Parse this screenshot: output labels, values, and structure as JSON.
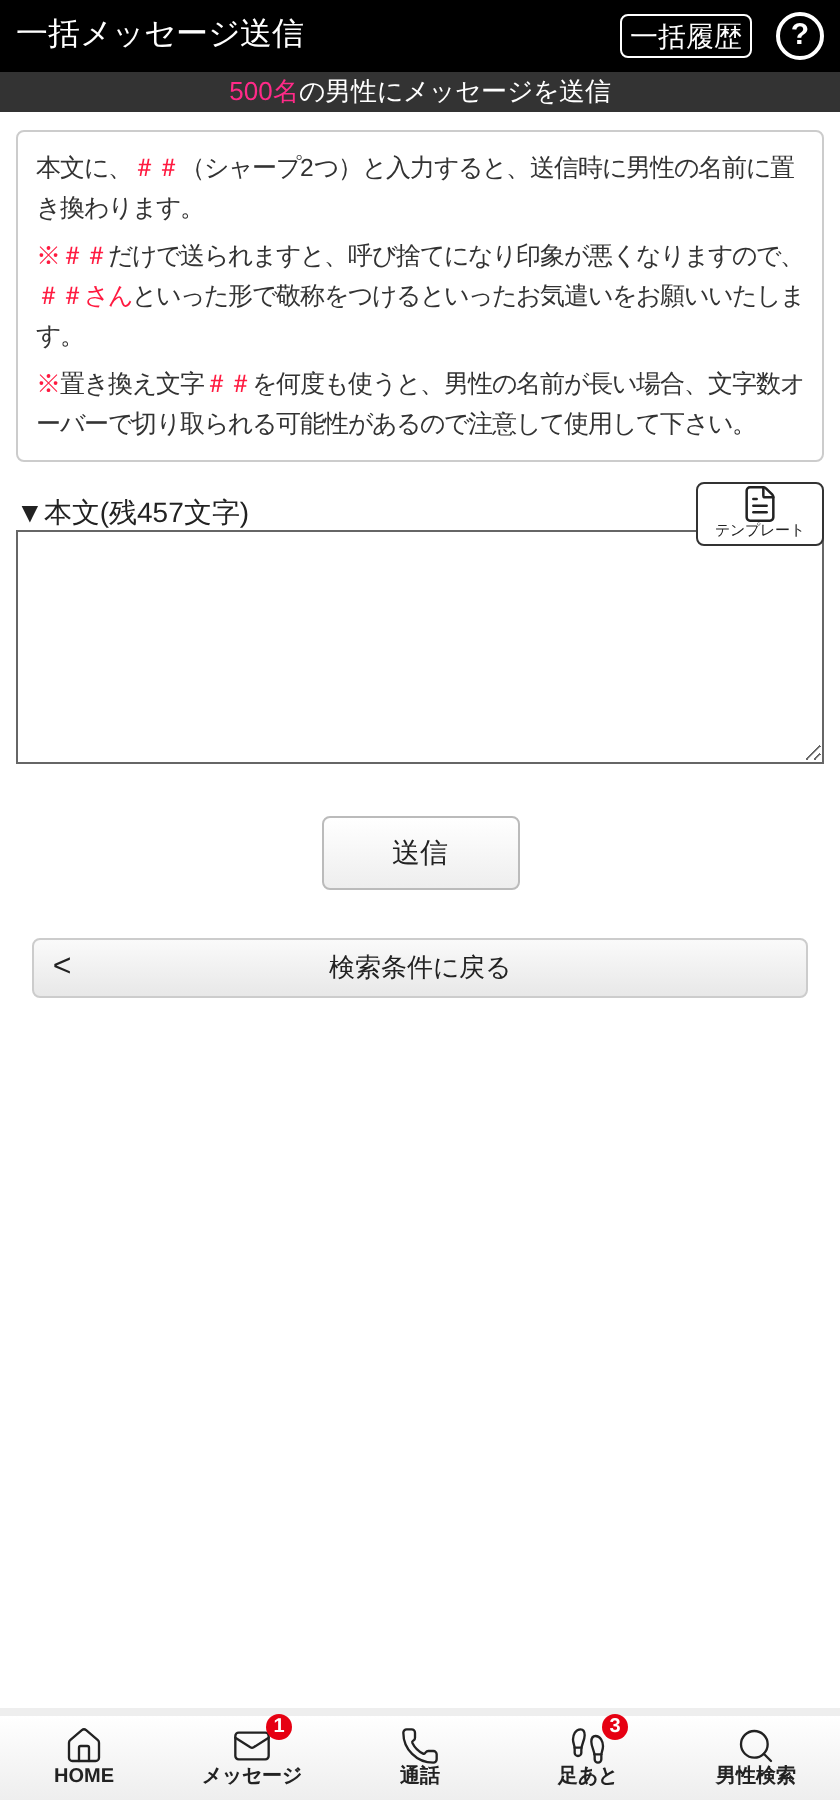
{
  "header": {
    "title": "一括メッセージ送信",
    "history_button": "一括履歴",
    "help_icon": "?"
  },
  "banner": {
    "count": "500名",
    "text": "の男性にメッセージを送信"
  },
  "notice": [
    {
      "segments": [
        {
          "text": "本文に、",
          "accent": false
        },
        {
          "text": "＃＃",
          "accent": true
        },
        {
          "text": "（シャープ2つ）と入力すると、送信時に男性の名前に置き換わります。",
          "accent": false
        }
      ]
    },
    {
      "segments": [
        {
          "text": "※＃＃",
          "accent": true
        },
        {
          "text": "だけで送られますと、呼び捨てになり印象が悪くなりますので、",
          "accent": false
        },
        {
          "text": "＃＃さん",
          "accent": true
        },
        {
          "text": "といった形で敬称をつけるといったお気遣いをお願いいたします。",
          "accent": false
        }
      ]
    },
    {
      "segments": [
        {
          "text": "※",
          "accent": true
        },
        {
          "text": "置き換え文字",
          "accent": false
        },
        {
          "text": "＃＃",
          "accent": true
        },
        {
          "text": "を何度も使うと、男性の名前が長い場合、文字数オーバーで切り取られる可能性があるので注意して使用して下さい。",
          "accent": false
        }
      ]
    }
  ],
  "body": {
    "label": "▼本文(残457文字)",
    "template_button": "テンプレート"
  },
  "send_button": "送信",
  "back_button": {
    "icon": "<",
    "label": "検索条件に戻る"
  },
  "bottom_nav": [
    {
      "kind": "home",
      "label": "HOME"
    },
    {
      "kind": "mail",
      "label": "メッセージ",
      "badge": "1"
    },
    {
      "kind": "phone",
      "label": "通話"
    },
    {
      "kind": "footprints",
      "label": "足あと",
      "badge": "3"
    },
    {
      "kind": "search",
      "label": "男性検索"
    }
  ]
}
